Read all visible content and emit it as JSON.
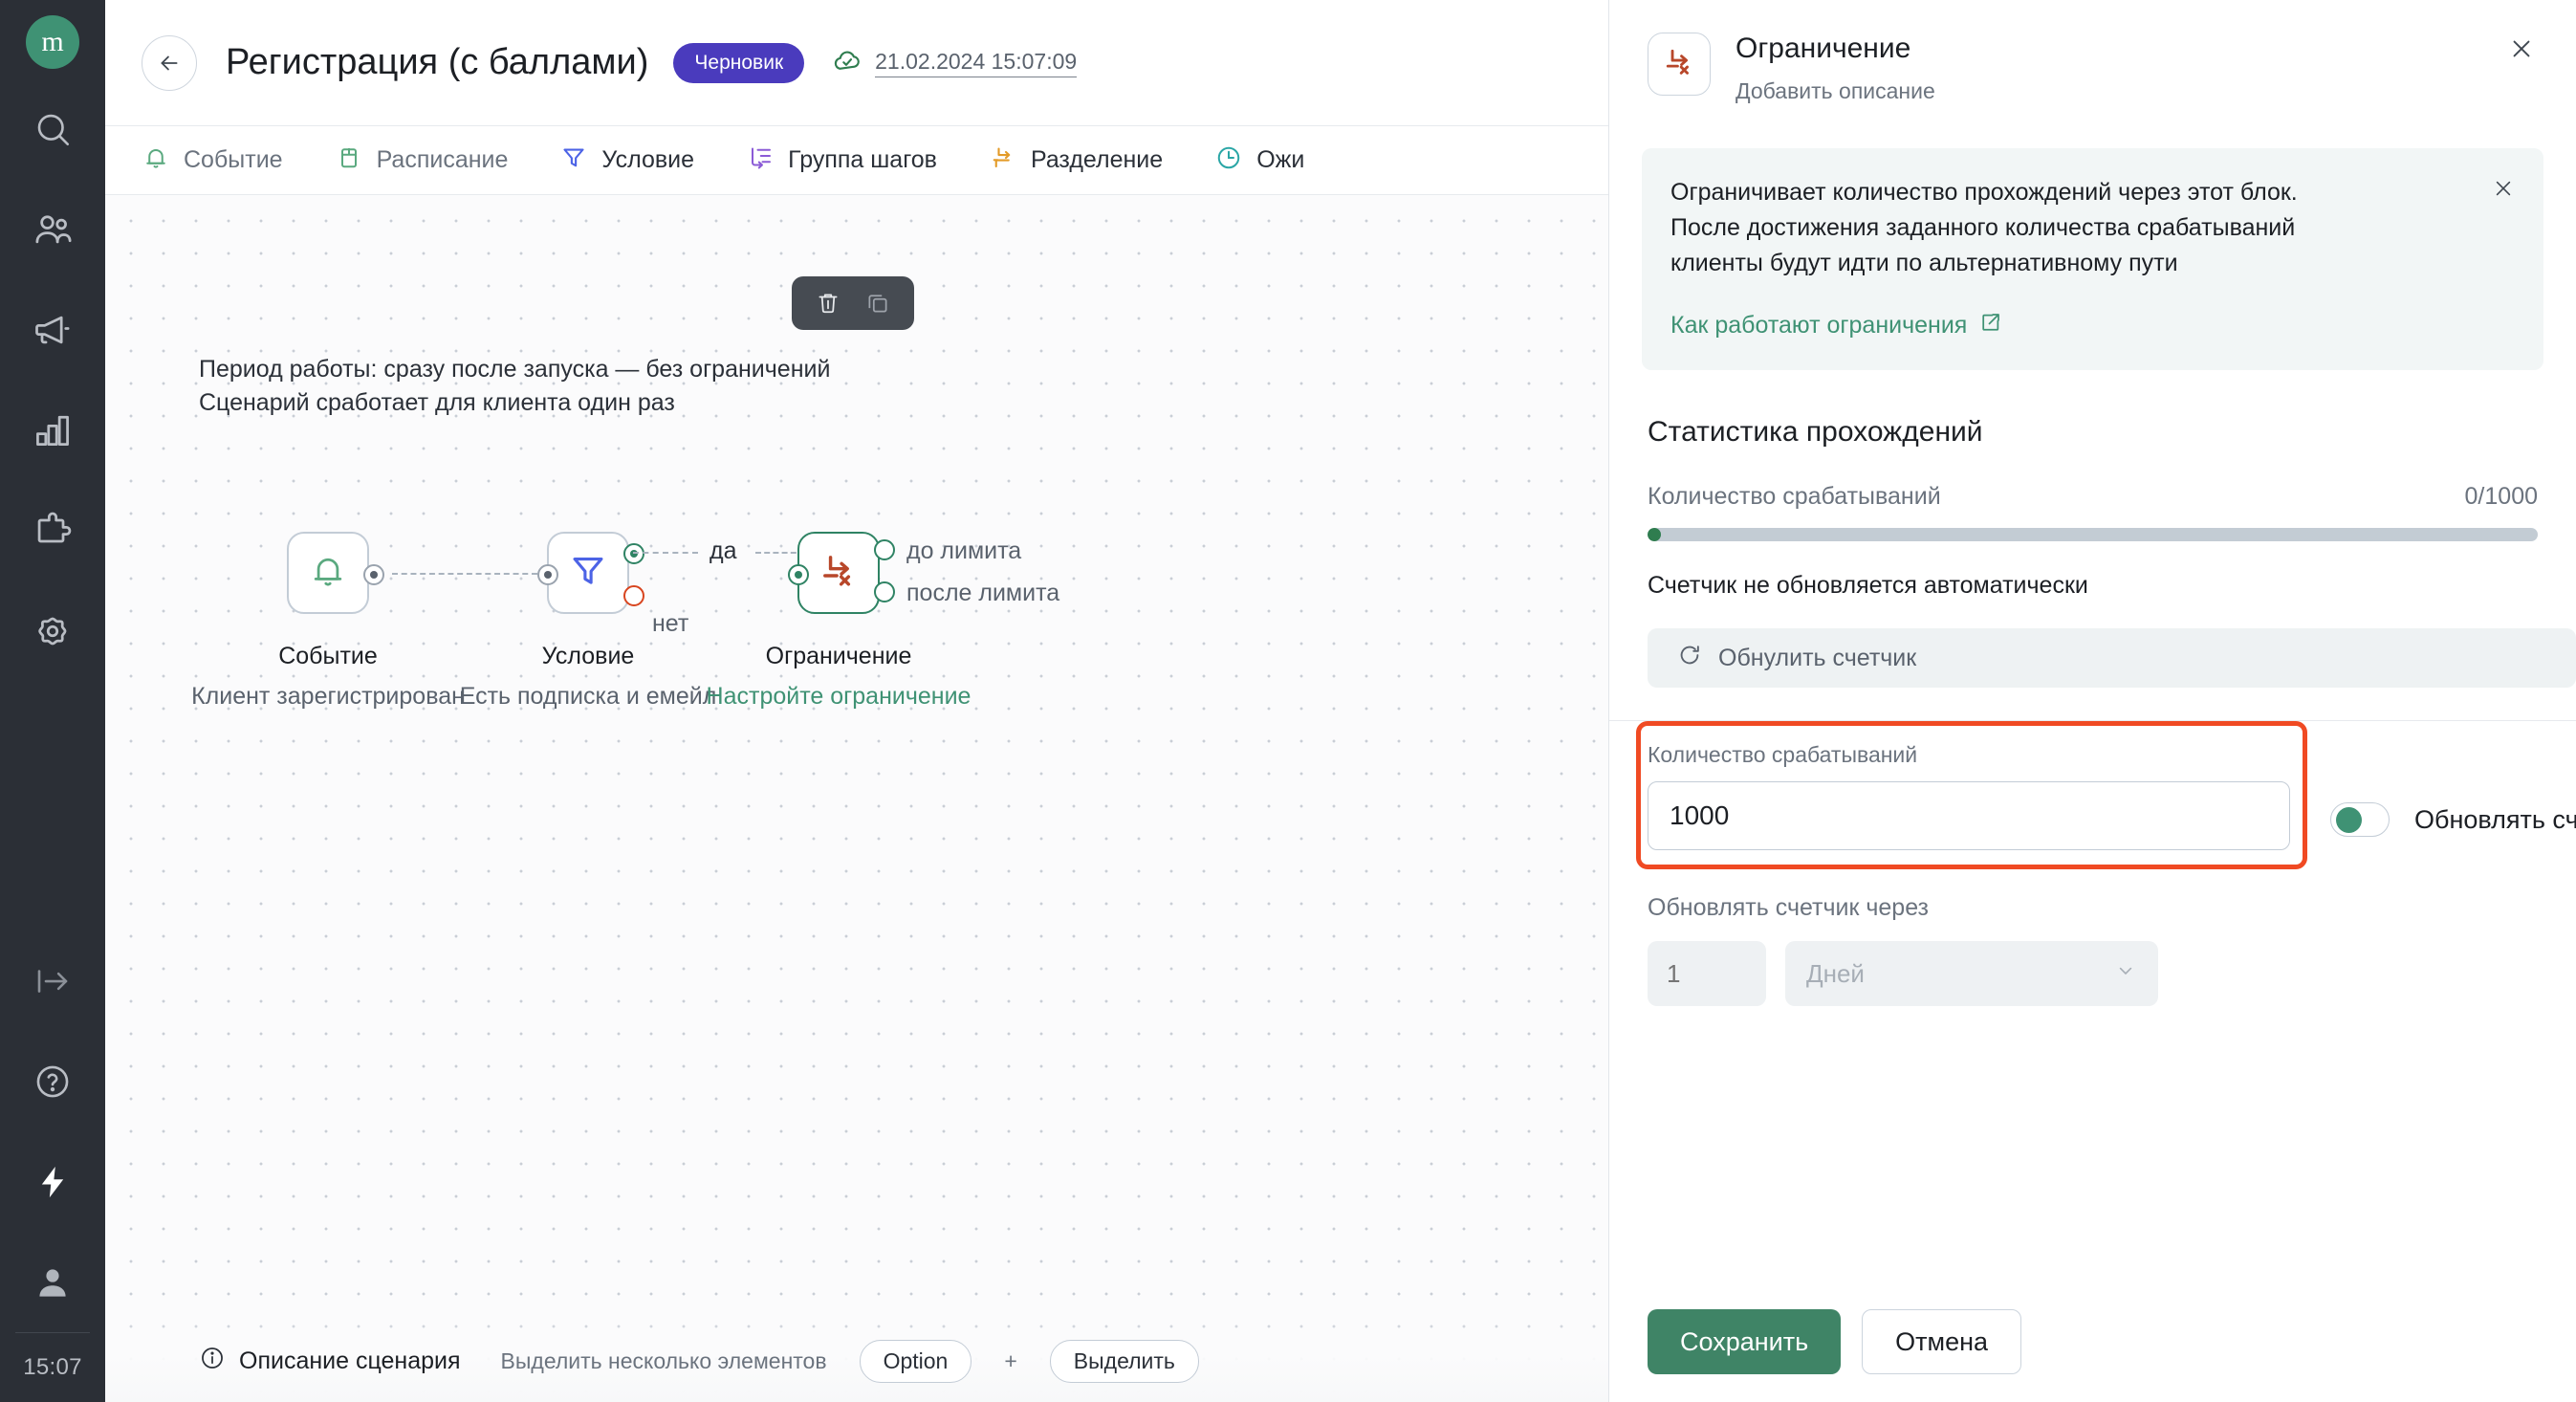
{
  "rail": {
    "logo_letter": "m",
    "items": [
      {
        "name": "search-icon",
        "label": "Поиск"
      },
      {
        "name": "contacts-icon",
        "label": "Контакты"
      },
      {
        "name": "campaigns-megaphone-icon",
        "label": "Кампании"
      },
      {
        "name": "analytics-bar-chart-icon",
        "label": "Аналитика"
      },
      {
        "name": "integrations-puzzle-icon",
        "label": "Интеграции"
      },
      {
        "name": "settings-gear-icon",
        "label": "Настройки"
      }
    ],
    "bottom_items": [
      {
        "name": "collapse-arrow-icon",
        "label": "Свернуть"
      },
      {
        "name": "help-question-icon",
        "label": "Помощь"
      },
      {
        "name": "lightning-icon",
        "label": "Быстрые действия"
      },
      {
        "name": "user-avatar-icon",
        "label": "Профиль"
      }
    ],
    "clock": "15:07"
  },
  "header": {
    "back_label": "←",
    "title": "Регистрация (с баллами)",
    "status_badge": "Черновик",
    "saved_icon": "cloud-check-icon",
    "saved_time": "21.02.2024 15:07:09"
  },
  "toolbar": {
    "items": [
      {
        "label": "Событие",
        "icon": "bell-icon",
        "color": "#5aa97f"
      },
      {
        "label": "Расписание",
        "icon": "calendar-icon",
        "color": "#5aa97f"
      },
      {
        "label": "Условие",
        "icon": "filter-icon",
        "color": "#4c63e6"
      },
      {
        "label": "Группа шагов",
        "icon": "step-group-icon",
        "color": "#8b5bd6"
      },
      {
        "label": "Разделение",
        "icon": "split-arrow-icon",
        "color": "#e39b28"
      },
      {
        "label": "Ожи",
        "icon": "clock-icon",
        "color": "#2aa6a6"
      }
    ]
  },
  "canvas": {
    "note_line1": "Период работы: сразу после запуска — без ограничений",
    "note_line2": "Сценарий сработает для клиента один раз",
    "nodes": [
      {
        "id": "event",
        "title": "Событие",
        "subtitle": "Клиент зарегистрирован",
        "icon": "bell-icon"
      },
      {
        "id": "condition",
        "title": "Условие",
        "subtitle": "Есть подписка и емейл",
        "icon": "filter-icon"
      },
      {
        "id": "limit",
        "title": "Ограничение",
        "subtitle": "Настройте ограничение",
        "icon": "limit-icon"
      }
    ],
    "edge_labels": {
      "yes": "да",
      "no": "нет"
    },
    "limit_ports": {
      "before": "до лимита",
      "after": "после лимита"
    },
    "node_toolbar": [
      {
        "name": "delete-node-button",
        "icon": "trash-icon"
      },
      {
        "name": "duplicate-node-button",
        "icon": "copy-icon"
      }
    ],
    "footer": {
      "description_label": "Описание сценария",
      "hint": "Выделить несколько элементов",
      "key1": "Option",
      "plus": "+",
      "key2": "Выделить"
    }
  },
  "panel": {
    "icon_name": "limit-icon",
    "title": "Ограничение",
    "subtitle": "Добавить описание",
    "close_label": "✕",
    "info": {
      "line1": "Ограничивает количество прохождений через этот блок.",
      "line2": "После достижения заданного количества срабатываний",
      "line3": "клиенты будут идти по альтернативному пути",
      "link_text": "Как работают ограничения",
      "link_icon": "external-link-icon",
      "close_label": "✕"
    },
    "stats": {
      "section_title": "Статистика прохождений",
      "label": "Количество срабатываний",
      "value": "0/1000",
      "progress_percent": 0,
      "note": "Счетчик не обновляется автоматически",
      "reset_button": "Обнулить счетчик",
      "reset_icon": "refresh-icon"
    },
    "form": {
      "count_label": "Количество срабатываний",
      "count_value": "1000",
      "count_placeholder": "Количество срабатываний",
      "toggle_label": "Обновлять счетчик",
      "toggle_on": true,
      "period_label": "Обновлять счетчик через",
      "period_number_placeholder": "1",
      "period_unit_placeholder": "Дней",
      "period_unit_chevron": "chevron-down-icon"
    },
    "footer": {
      "save_label": "Сохранить",
      "cancel_label": "Отмена"
    }
  },
  "colors": {
    "brand_green": "#3f9274",
    "draft_purple": "#4a3bbd",
    "highlight_orange": "#f04a23",
    "limit_red": "#b8472a",
    "rail_bg": "#2b2f36"
  }
}
